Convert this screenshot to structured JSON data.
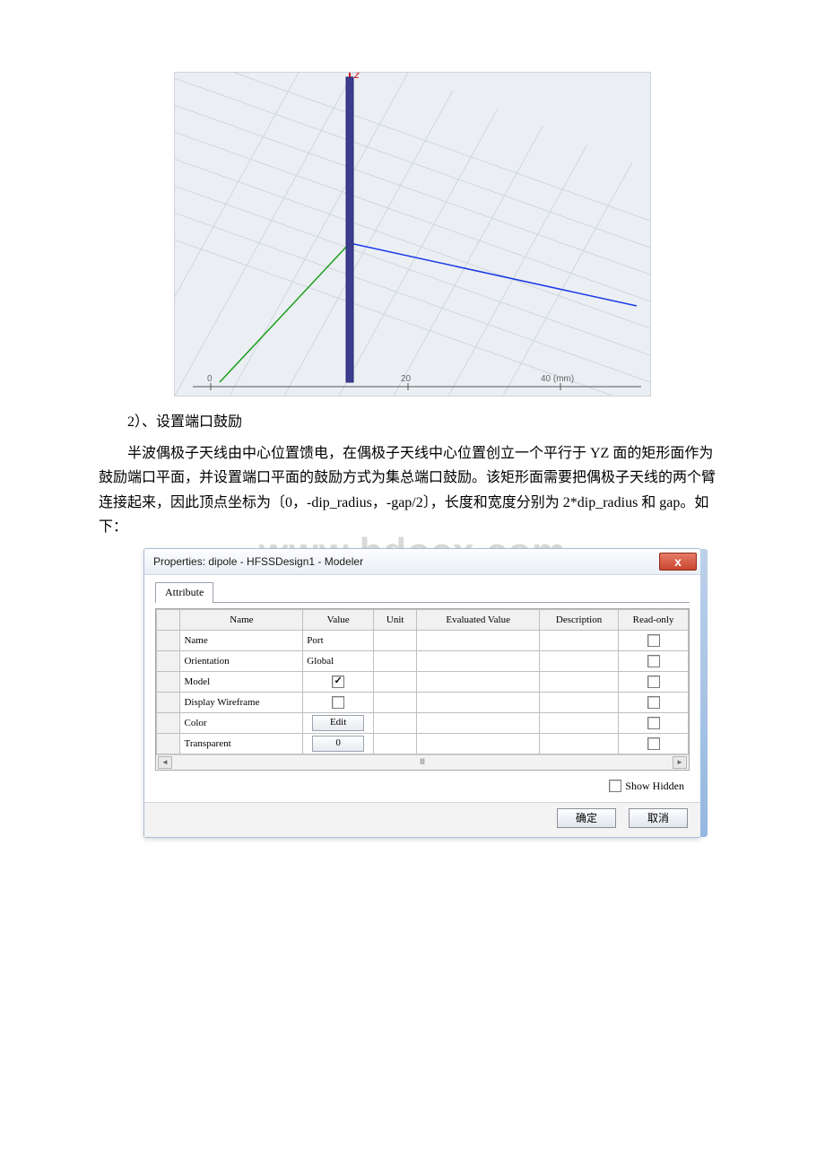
{
  "doc": {
    "sec_label": "2）、设置端口鼓励",
    "body1": "半波偶极子天线由中心位置馈电，在偶极子天线中心位置创立一个平行于 YZ 面的矩形面作为鼓励端口平面，并设置端口平面的鼓励方式为集总端口鼓励。该矩形面需要把偶极子天线的两个臂连接起来，因此顶点坐标为〔0，-dip_radius，-gap/2〕，长度和宽度分别为 2*dip_radius 和 gap。如下：",
    "watermark": "www.bdocx.com",
    "axis_z": "z",
    "ruler_marks": [
      "0",
      "20",
      "40 (mm)"
    ]
  },
  "dialog": {
    "title": "Properties: dipole - HFSSDesign1 - Modeler",
    "close_label": "x",
    "tab": "Attribute",
    "columns": [
      "Name",
      "Value",
      "Unit",
      "Evaluated Value",
      "Description",
      "Read-only"
    ],
    "rows": [
      {
        "name": "Name",
        "value": "Port",
        "kind": "text"
      },
      {
        "name": "Orientation",
        "value": "Global",
        "kind": "text"
      },
      {
        "name": "Model",
        "value": "",
        "kind": "check",
        "checked": true
      },
      {
        "name": "Display Wireframe",
        "value": "",
        "kind": "check",
        "checked": false
      },
      {
        "name": "Color",
        "value": "Edit",
        "kind": "button"
      },
      {
        "name": "Transparent",
        "value": "0",
        "kind": "button"
      }
    ],
    "show_hidden": "Show Hidden",
    "ok": "确定",
    "cancel": "取消"
  }
}
